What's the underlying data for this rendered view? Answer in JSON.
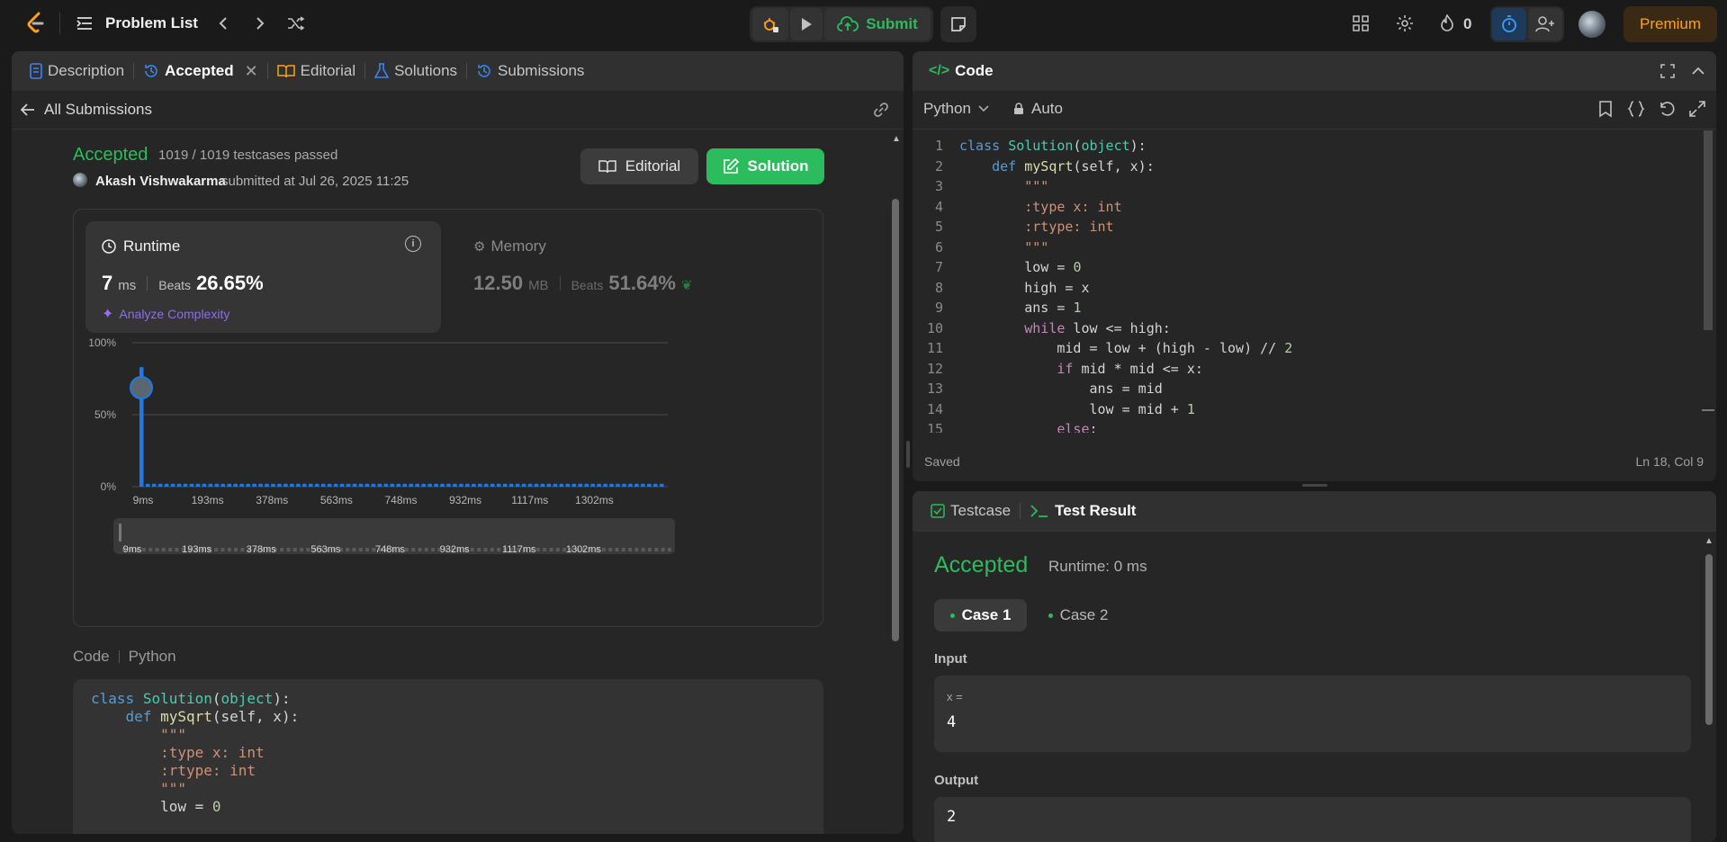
{
  "topbar": {
    "title": "Problem List",
    "submit": "Submit",
    "streak": "0",
    "premium": "Premium"
  },
  "left": {
    "tabs": [
      "Description",
      "Accepted",
      "Editorial",
      "Solutions",
      "Submissions"
    ],
    "back": "All Submissions",
    "status": "Accepted",
    "testcases": "1019 / 1019 testcases passed",
    "user": "Akash Vishwakarma",
    "submitted": "submitted at Jul 26, 2025 11:25",
    "editorial_btn": "Editorial",
    "solution_btn": "Solution",
    "runtime_label": "Runtime",
    "runtime_val": "7",
    "runtime_unit": "ms",
    "beats": "Beats",
    "runtime_beats": "26.65%",
    "analyze": "Analyze Complexity",
    "memory_label": "Memory",
    "memory_val": "12.50",
    "memory_unit": "MB",
    "memory_beats": "51.64%",
    "code_label": "Code",
    "code_lang": "Python"
  },
  "chart_data": {
    "type": "bar",
    "yticks": [
      "100%",
      "50%",
      "0%"
    ],
    "xticks": [
      "9ms",
      "193ms",
      "378ms",
      "563ms",
      "748ms",
      "932ms",
      "1117ms",
      "1302ms"
    ],
    "ylim": [
      0,
      100
    ],
    "first_bar_value": 83,
    "minor_bar_value": 2,
    "highlight": "7 ms"
  },
  "editor": {
    "title": "Code",
    "lang": "Python",
    "auto": "Auto",
    "saved": "Saved",
    "cursor": "Ln 18, Col 9",
    "lines": [
      "class Solution(object):",
      "    def mySqrt(self, x):",
      "        \"\"\"",
      "        :type x: int",
      "        :rtype: int",
      "        \"\"\"",
      "        low = 0",
      "        high = x",
      "        ans = 1",
      "        while low <= high:",
      "            mid = low + (high - low) // 2",
      "            if mid * mid <= x:",
      "                ans = mid",
      "                low = mid + 1",
      "            else:"
    ]
  },
  "snippet": {
    "lines": [
      "class Solution(object):",
      "    def mySqrt(self, x):",
      "        \"\"\"",
      "        :type x: int",
      "        :rtype: int",
      "        \"\"\"",
      "        low = 0"
    ]
  },
  "result": {
    "tab1": "Testcase",
    "tab2": "Test Result",
    "status": "Accepted",
    "runtime": "Runtime: 0 ms",
    "case1": "Case 1",
    "case2": "Case 2",
    "input_label": "Input",
    "input_var": "x =",
    "input_val": "4",
    "output_label": "Output",
    "output_val": "2"
  }
}
